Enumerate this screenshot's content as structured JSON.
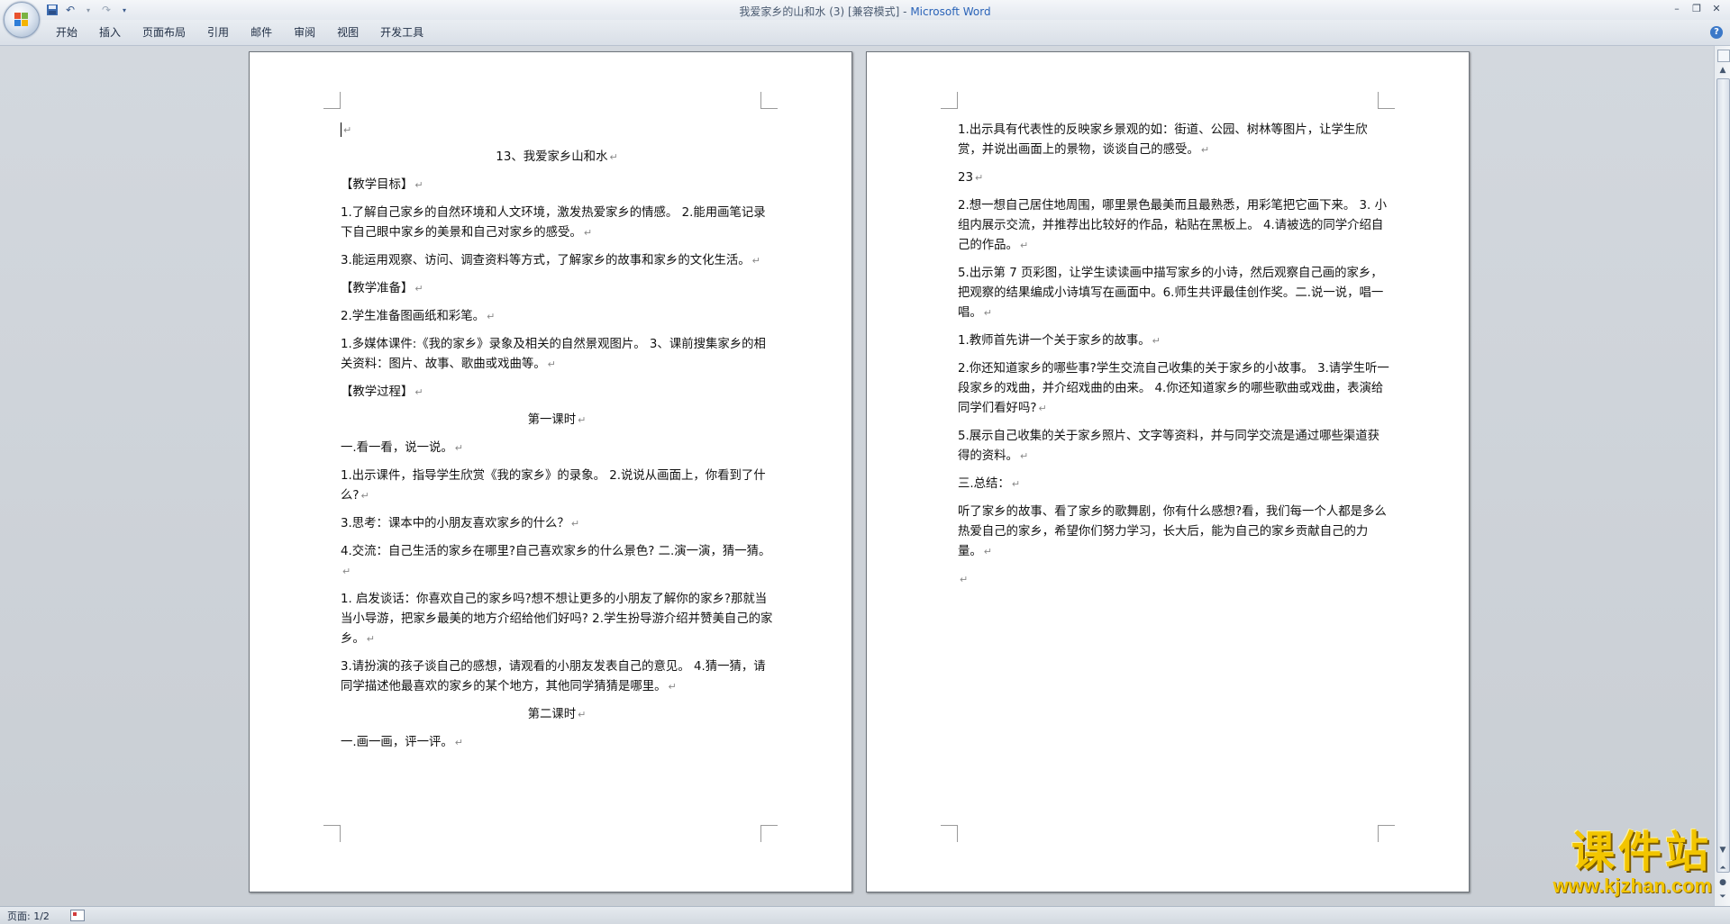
{
  "window": {
    "title_prefix": "我爱家乡的山和水 (3) [兼容模式] - ",
    "title_brand": "Microsoft Word"
  },
  "icons": {
    "office_button": "office-logo-icon",
    "save": "save-icon",
    "undo": "undo-icon",
    "redo": "redo-icon",
    "customize": "dropdown-icon",
    "help": "help-icon"
  },
  "ribbon": {
    "tabs": [
      "开始",
      "插入",
      "页面布局",
      "引用",
      "邮件",
      "审阅",
      "视图",
      "开发工具"
    ]
  },
  "page1": {
    "lines": [
      "13、我爱家乡山和水",
      "【教学目标】",
      "1.了解自己家乡的自然环境和人文环境，激发热爱家乡的情感。 2.能用画笔记录下自己眼中家乡的美景和自己对家乡的感受。",
      "3.能运用观察、访问、调查资料等方式，了解家乡的故事和家乡的文化生活。",
      "【教学准备】",
      "2.学生准备图画纸和彩笔。",
      "1.多媒体课件:《我的家乡》录象及相关的自然景观图片。 3、课前搜集家乡的相关资料：图片、故事、歌曲或戏曲等。",
      "【教学过程】",
      "第一课时",
      "一.看一看，说一说。",
      "1.出示课件，指导学生欣赏《我的家乡》的录象。 2.说说从画面上，你看到了什么?",
      "3.思考：课本中的小朋友喜欢家乡的什么？",
      "4.交流：自己生活的家乡在哪里?自己喜欢家乡的什么景色? 二.演一演，猜一猜。",
      "1. 启发谈话：你喜欢自己的家乡吗?想不想让更多的小朋友了解你的家乡?那就当当小导游，把家乡最美的地方介绍给他们好吗? 2.学生扮导游介绍并赞美自己的家乡。",
      "3.请扮演的孩子谈自己的感想，请观看的小朋友发表自己的意见。 4.猜一猜，请同学描述他最喜欢的家乡的某个地方，其他同学猜猜是哪里。",
      "第二课时",
      "一.画一画，评一评。"
    ]
  },
  "page2": {
    "lines": [
      "1.出示具有代表性的反映家乡景观的如：街道、公园、树林等图片，让学生欣赏，并说出画面上的景物，谈谈自己的感受。",
      "23",
      "2.想一想自己居住地周围，哪里景色最美而且最熟悉，用彩笔把它画下来。 3. 小组内展示交流，并推荐出比较好的作品，粘贴在黑板上。 4.请被选的同学介绍自己的作品。",
      "5.出示第 7 页彩图，让学生读读画中描写家乡的小诗，然后观察自己画的家乡，把观察的结果编成小诗填写在画面中。6.师生共评最佳创作奖。二.说一说，唱一唱。",
      "1.教师首先讲一个关于家乡的故事。",
      "2.你还知道家乡的哪些事?学生交流自己收集的关于家乡的小故事。 3.请学生听一段家乡的戏曲，并介绍戏曲的由来。 4.你还知道家乡的哪些歌曲或戏曲，表演给同学们看好吗?",
      "5.展示自己收集的关于家乡照片、文字等资料，并与同学交流是通过哪些渠道获得的资料。",
      "三.总结：",
      "听了家乡的故事、看了家乡的歌舞剧，你有什么感想?看，我们每一个人都是多么热爱自己的家乡，希望你们努力学习，长大后，能为自己的家乡贡献自己的力量。"
    ]
  },
  "paragraph_mark": "↵",
  "status": {
    "page": "页面: 1/2"
  },
  "watermark": {
    "cn": "课件站",
    "url": "www.kjzhan.com"
  }
}
